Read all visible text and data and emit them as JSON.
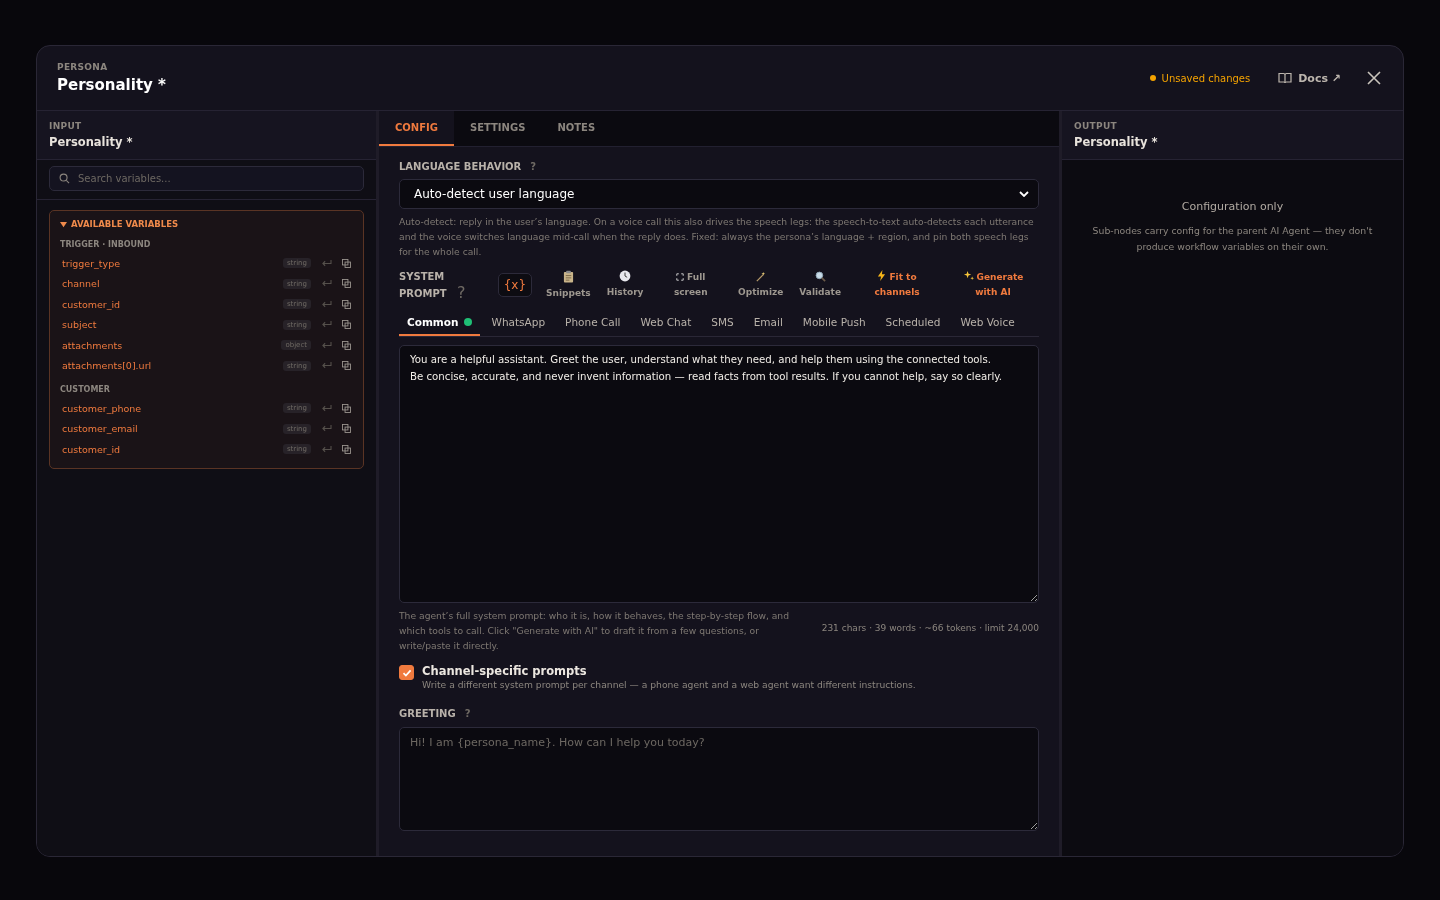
{
  "modal": {
    "eyebrow": "PERSONA",
    "title": "Personality *",
    "unsaved": {
      "label": "Unsaved changes",
      "color": "#f5a300"
    },
    "docs": "Docs ↗"
  },
  "input_panel": {
    "eyebrow": "INPUT",
    "title": "Personality *",
    "search": {
      "placeholder": "Search variables..."
    },
    "variables": {
      "heading": "AVAILABLE VARIABLES",
      "expanded": true,
      "groups": [
        {
          "label": "TRIGGER · INBOUND",
          "items": [
            {
              "name": "trigger_type",
              "type": "string"
            },
            {
              "name": "channel",
              "type": "string"
            },
            {
              "name": "customer_id",
              "type": "string"
            },
            {
              "name": "subject",
              "type": "string"
            },
            {
              "name": "attachments",
              "type": "object"
            },
            {
              "name": "attachments[0].url",
              "type": "string"
            }
          ]
        },
        {
          "label": "CUSTOMER",
          "items": [
            {
              "name": "customer_phone",
              "type": "string"
            },
            {
              "name": "customer_email",
              "type": "string"
            },
            {
              "name": "customer_id",
              "type": "string"
            }
          ]
        }
      ]
    }
  },
  "tabs": [
    {
      "label": "CONFIG",
      "selected": true
    },
    {
      "label": "SETTINGS",
      "selected": false
    },
    {
      "label": "NOTES",
      "selected": false
    }
  ],
  "language": {
    "label": "LANGUAGE BEHAVIOR",
    "help": "?",
    "value": "Auto-detect user language",
    "hint": "Auto-detect: reply in the user’s language. On a voice call this also drives the speech legs: the speech-to-text auto-detects each utterance and the voice switches language mid-call when the reply does. Fixed: always the persona’s language + region, and pin both speech legs for the whole call."
  },
  "system_prompt": {
    "label": "SYSTEM PROMPT",
    "help": "?",
    "variable_button": "{x}",
    "tools": [
      {
        "label": "Snippets",
        "kind": "clipboard",
        "accent": false
      },
      {
        "label": "History",
        "kind": "clock",
        "accent": false
      },
      {
        "label": "Full screen",
        "kind": "expand",
        "accent": false
      },
      {
        "label": "Optimize",
        "kind": "wand",
        "accent": false
      },
      {
        "label": "Validate",
        "kind": "magnifier",
        "accent": false
      },
      {
        "label": "Fit to channels",
        "kind": "bolt",
        "accent": true
      },
      {
        "label": "Generate with AI",
        "kind": "sparkle",
        "accent": true
      }
    ],
    "channels": [
      {
        "label": "Common",
        "selected": true,
        "color": "#1fbf75"
      },
      {
        "label": "WhatsApp",
        "selected": false
      },
      {
        "label": "Phone Call",
        "selected": false
      },
      {
        "label": "Web Chat",
        "selected": false
      },
      {
        "label": "SMS",
        "selected": false
      },
      {
        "label": "Email",
        "selected": false
      },
      {
        "label": "Mobile Push",
        "selected": false
      },
      {
        "label": "Scheduled",
        "selected": false
      },
      {
        "label": "Web Voice",
        "selected": false
      }
    ],
    "value": "You are a helpful assistant. Greet the user, understand what they need, and help them using the connected tools.\nBe concise, accurate, and never invent information — read facts from tool results. If you cannot help, say so clearly.",
    "hint": "The agent’s full system prompt: who it is, how it behaves, the step-by-step flow, and which tools to call. Click \"Generate with AI\" to draft it from a few questions, or write/paste it directly.",
    "stats": "231 chars · 39 words · ~66 tokens · limit 24,000"
  },
  "channel_specific": {
    "checked": true,
    "label": "Channel-specific prompts",
    "description": "Write a different system prompt per channel — a phone agent and a web agent want different instructions."
  },
  "greeting": {
    "label": "GREETING",
    "help": "?",
    "placeholder": "Hi! I am {persona_name}. How can I help you today?"
  },
  "output_panel": {
    "eyebrow": "OUTPUT",
    "title": "Personality *",
    "empty_title": "Configuration only",
    "empty_text": "Sub-nodes carry config for the parent AI Agent — they don't produce workflow variables on their own."
  }
}
